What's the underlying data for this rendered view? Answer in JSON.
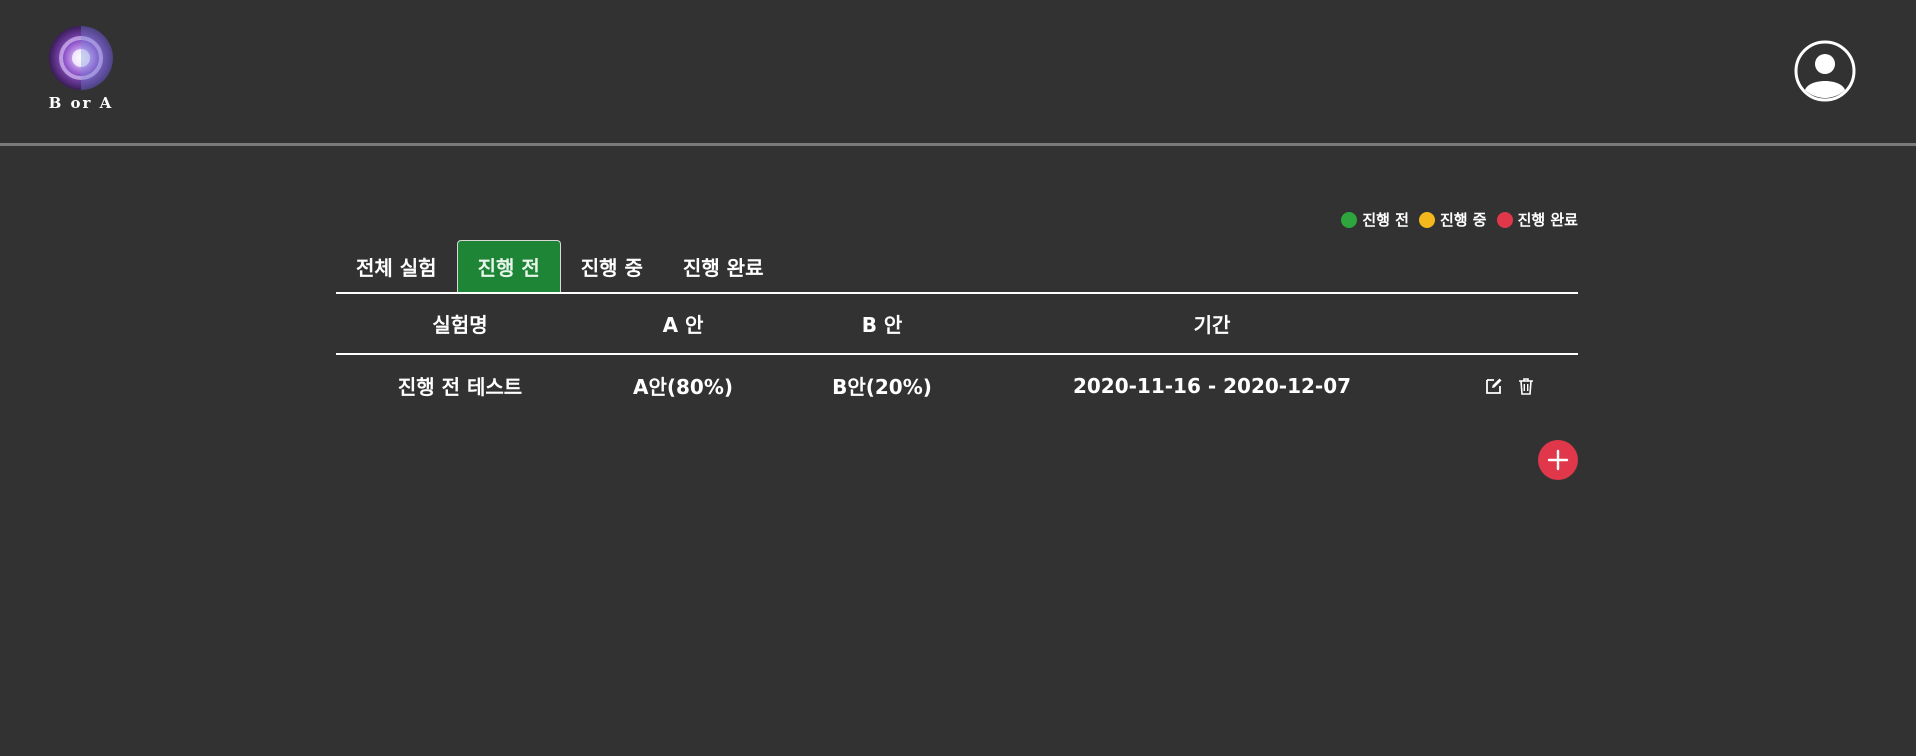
{
  "brand": {
    "logo_text": "B or A"
  },
  "colors": {
    "background": "#323232",
    "status_before": "#2fa53e",
    "status_in_progress": "#f4b81c",
    "status_done": "#e0384a",
    "active_tab": "#1e8436",
    "add_button": "#e0384a"
  },
  "header": {
    "profile_icon": "user-avatar-icon"
  },
  "legend": [
    {
      "label": "진행 전",
      "color": "#2fa53e"
    },
    {
      "label": "진행 중",
      "color": "#f4b81c"
    },
    {
      "label": "진행 완료",
      "color": "#e0384a"
    }
  ],
  "tabs": [
    {
      "label": "전체 실험",
      "active": false
    },
    {
      "label": "진행 전",
      "active": true
    },
    {
      "label": "진행 중",
      "active": false
    },
    {
      "label": "진행 완료",
      "active": false
    }
  ],
  "table": {
    "columns": [
      "실험명",
      "A 안",
      "B 안",
      "기간"
    ],
    "rows": [
      {
        "name": "진행 전 테스트",
        "a": "A안(80%)",
        "b": "B안(20%)",
        "period": "2020-11-16 - 2020-12-07"
      }
    ],
    "row_actions": [
      "edit-icon",
      "trash-icon"
    ]
  },
  "add_button_icon": "plus-icon"
}
